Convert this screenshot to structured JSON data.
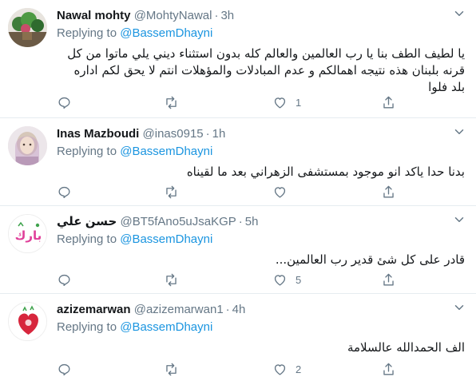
{
  "tweets": [
    {
      "name": "Nawal mohty",
      "handle": "@MohtyNawal",
      "time": "3h",
      "replying_label": "Replying to",
      "replying_to": "@BassemDhayni",
      "text": "يا لطيف الطف بنا يا رب العالمين والعالم كله بدون استثناء ديني يلي ماتوا من كل قرنه بلبنان هذه نتيجه اهمالكم و عدم المبادلات والمؤهلات انتم لا يحق لكم اداره بلد فلوا",
      "reply_count": "",
      "retweet_count": "",
      "like_count": "1"
    },
    {
      "name": "Inas Mazboudi",
      "handle": "@inas0915",
      "time": "1h",
      "replying_label": "Replying to",
      "replying_to": "@BassemDhayni",
      "text": "بدنا حدا ياكد انو موجود بمستشفى الزهراني بعد ما لقيناه",
      "reply_count": "",
      "retweet_count": "",
      "like_count": ""
    },
    {
      "name": "حسن علي",
      "handle": "@BT5fAno5uJsaKGP",
      "time": "5h",
      "replying_label": "Replying to",
      "replying_to": "@BassemDhayni",
      "text": "قادر على كل شئ قدير رب العالمين...",
      "reply_count": "",
      "retweet_count": "",
      "like_count": "5"
    },
    {
      "name": "azizemarwan",
      "handle": "@azizemarwan1",
      "time": "4h",
      "replying_label": "Replying to",
      "replying_to": "@BassemDhayni",
      "text": "الف الحمدالله عالسلامة",
      "reply_count": "",
      "retweet_count": "",
      "like_count": "2"
    }
  ],
  "avatar_logo_text": "بارك",
  "icons": {
    "reply": "reply-icon",
    "retweet": "retweet-icon",
    "like": "heart-icon",
    "share": "share-icon",
    "caret": "chevron-down-icon"
  },
  "colors": {
    "link": "#1b95e0",
    "secondary": "#657786",
    "divider": "#e6ecf0",
    "text": "#14171a"
  }
}
